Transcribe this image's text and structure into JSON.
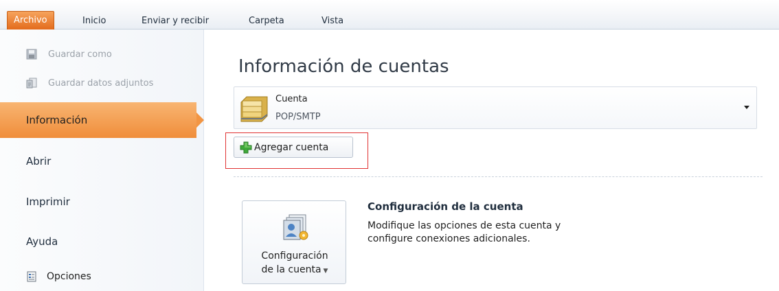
{
  "ribbon": {
    "tabs": [
      {
        "label": "Archivo",
        "active": true
      },
      {
        "label": "Inicio"
      },
      {
        "label": "Enviar y recibir"
      },
      {
        "label": "Carpeta"
      },
      {
        "label": "Vista"
      }
    ],
    "accent": "#e8731f"
  },
  "sidebar": {
    "save_as": "Guardar como",
    "save_attachments": "Guardar datos adjuntos",
    "items": [
      "Información",
      "Abrir",
      "Imprimir",
      "Ayuda"
    ],
    "options": "Opciones",
    "selected_color": "#f29543"
  },
  "main": {
    "title": "Información de cuentas",
    "account": {
      "name": "Cuenta",
      "type": "POP/SMTP"
    },
    "add_account": "Agregar cuenta",
    "settings": {
      "button_line1": "Configuración",
      "button_line2": "de la cuenta",
      "heading": "Configuración de la cuenta",
      "description": "Modifique las opciones de esta cuenta y configure conexiones adicionales."
    }
  }
}
